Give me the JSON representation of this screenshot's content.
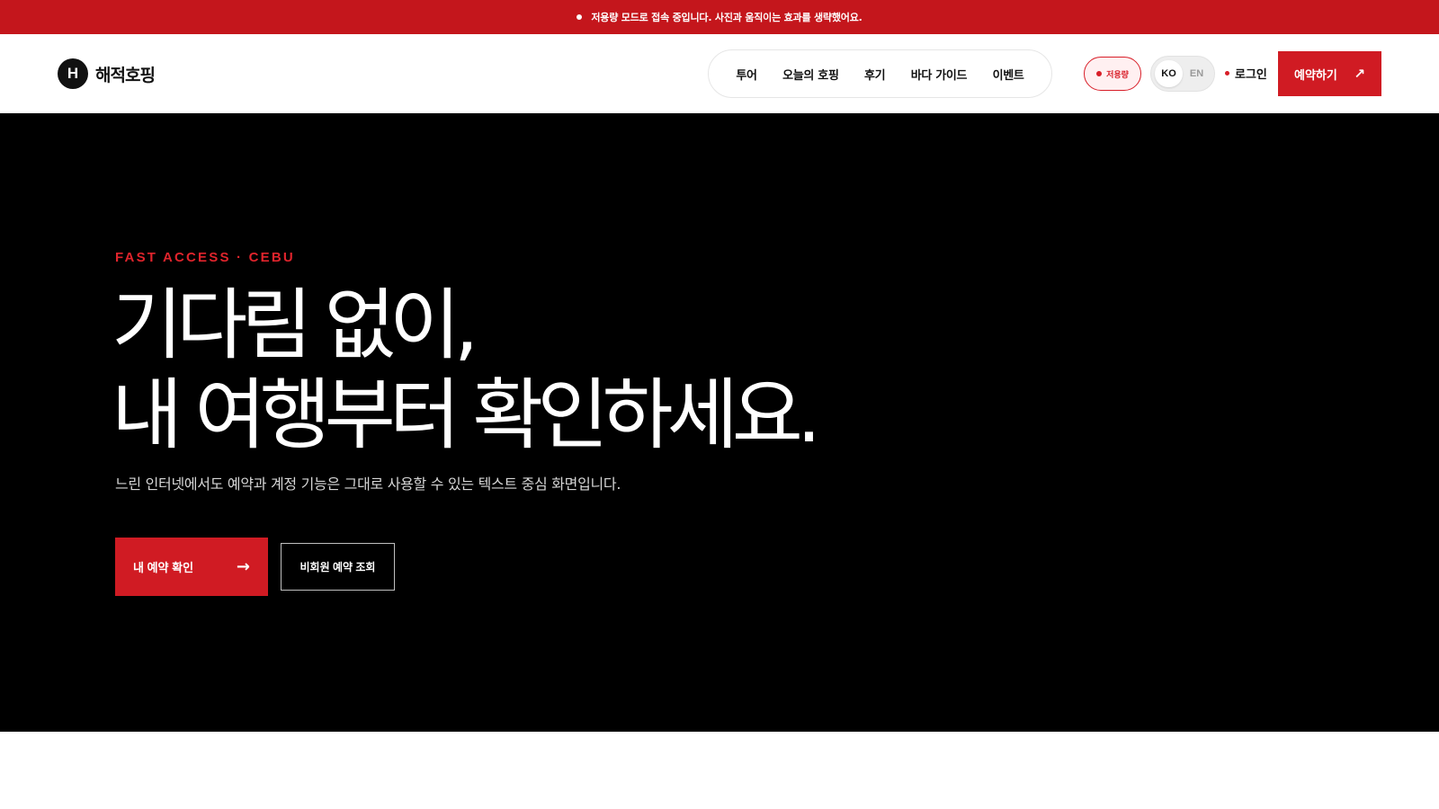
{
  "banner": {
    "text": "저용량 모드로 접속 중입니다. 사진과 움직이는 효과를 생략했어요."
  },
  "header": {
    "logo_mark": "H",
    "logo_text": "해적호핑",
    "nav": [
      "투어",
      "오늘의 호핑",
      "후기",
      "바다 가이드",
      "이벤트"
    ],
    "lite_badge": "저용량",
    "lang": {
      "active": "KO",
      "inactive": "EN"
    },
    "login": "로그인",
    "cta": "예약하기",
    "cta_icon": "↗"
  },
  "hero": {
    "eyebrow": "FAST ACCESS · CEBU",
    "headline_line1": "기다림 없이,",
    "headline_line2": "내 여행부터 확인하세요.",
    "subtext": "느린 인터넷에서도 예약과 계정 기능은 그대로 사용할 수 있는 텍스트 중심 화면입니다.",
    "primary_button": "내 예약 확인",
    "primary_icon": "→",
    "secondary_button": "비회원 예약 조회"
  },
  "colors": {
    "brand_red": "#d01b23",
    "banner_red": "#c4161c",
    "hero_bg": "#000000"
  }
}
